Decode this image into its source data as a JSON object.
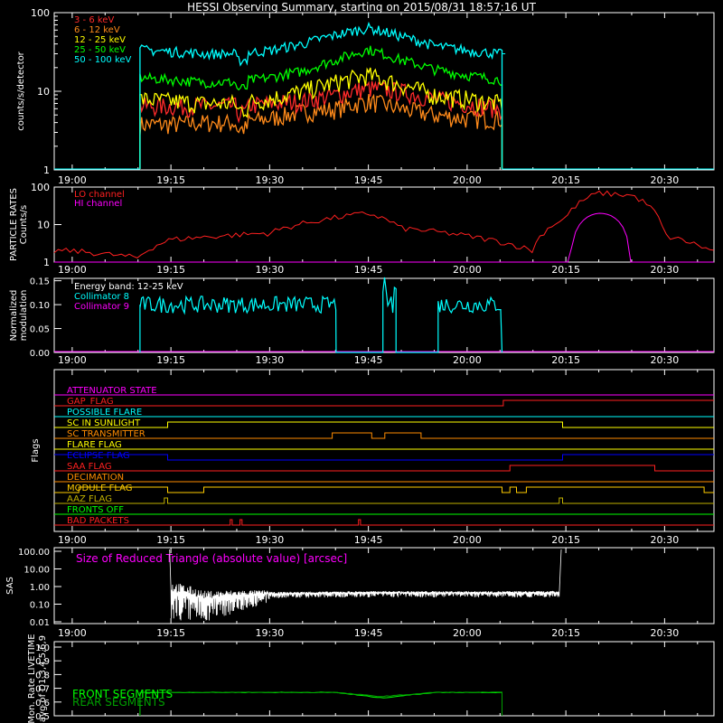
{
  "title": "HESSI Observing Summary, starting on 2015/08/31 18:57:16 UT",
  "colors": {
    "bg": "#000000",
    "fg": "#ffffff",
    "e1": "#ff2a2a",
    "e2": "#ff8a1a",
    "e3": "#ffff00",
    "e4": "#00ff00",
    "e5": "#00ffff",
    "magenta": "#ff00ff",
    "cyan": "#00ffff",
    "green": "#00ff00",
    "blue": "#0000ff",
    "yellow": "#ffff00",
    "orange": "#ff8c00",
    "red": "#ff2020",
    "olive": "#c0b000",
    "gold": "#ffcc00",
    "darkgreen": "#00a000"
  },
  "time_ticks": [
    "19:00",
    "19:15",
    "19:30",
    "19:45",
    "20:00",
    "20:15",
    "20:30"
  ],
  "panels": {
    "counts": {
      "ylabel": "counts/s/detector",
      "yticks": [
        "100",
        "10",
        "1"
      ],
      "legend": [
        "3 - 6 keV",
        "6 - 12 keV",
        "12 - 25 keV",
        "25 - 50 keV",
        "50 - 100 keV"
      ]
    },
    "particle": {
      "ylabel1": "PARTICLE RATES",
      "ylabel2": "Counts/s",
      "yticks": [
        "100",
        "10",
        "1"
      ],
      "legend": [
        "LO channel",
        "HI channel"
      ]
    },
    "modulation": {
      "ylabel1": "Normalized",
      "ylabel2": "modulation",
      "yticks": [
        "0.15",
        "0.10",
        "0.05",
        "0.00"
      ],
      "legend": [
        "Energy band: 12-25 keV",
        "Collimator 8",
        "Collimator 9"
      ]
    },
    "flags": {
      "ylabel": "Flags",
      "labels": [
        "ATTENUATOR STATE",
        "GAP_FLAG",
        "POSSIBLE FLARE",
        "SC IN SUNLIGHT",
        "SC TRANSMITTER",
        "FLARE FLAG",
        "ECLIPSE FLAG",
        "SAA FLAG",
        "DECIMATION",
        "MODULE FLAG",
        "AAZ FLAG",
        "FRONTS OFF",
        "BAD PACKETS"
      ]
    },
    "sas": {
      "ylabel": "SAS",
      "yticks": [
        "100.00",
        "10.00",
        "1.00",
        "0.10",
        "0.01"
      ],
      "legend": "Size of Reduced Triangle (absolute value) [arcsec]"
    },
    "livetime": {
      "ylabel1": "Mon. Rate LIVETIME",
      "ylabel2": "avg of D1,3,4,5,6,9",
      "yticks": [
        "1.0",
        "0.9",
        "0.8",
        "0.7",
        "0.6",
        "0.5"
      ],
      "legend": [
        "FRONT SEGMENTS",
        "REAR SEGMENTS"
      ]
    }
  },
  "chart_data": [
    {
      "type": "line",
      "title": "HESSI Observing Summary, starting on 2015/08/31 18:57:16 UT",
      "ylabel": "counts/s/detector",
      "yscale": "log",
      "ylim": [
        1,
        100
      ],
      "x": [
        "19:10",
        "19:15",
        "19:20",
        "19:25",
        "19:30",
        "19:35",
        "19:40",
        "19:45",
        "19:50",
        "19:55",
        "20:00",
        "20:05"
      ],
      "series": [
        {
          "name": "3 - 6 keV",
          "color": "#ff2a2a",
          "values": [
            6.5,
            6.5,
            6.5,
            6.5,
            7,
            7.5,
            9,
            11,
            10,
            8,
            7,
            6
          ]
        },
        {
          "name": "6 - 12 keV",
          "color": "#ff8a1a",
          "values": [
            3.8,
            3.8,
            4,
            4,
            4.5,
            5.5,
            6,
            7.5,
            6,
            5,
            4.5,
            4.5
          ]
        },
        {
          "name": "12 - 25 keV",
          "color": "#ffff00",
          "values": [
            8,
            7.5,
            7,
            7,
            8,
            10,
            13,
            16,
            12,
            9,
            8,
            7
          ]
        },
        {
          "name": "25 - 50 keV",
          "color": "#00ff00",
          "values": [
            15,
            14,
            13,
            13,
            15,
            18,
            25,
            34,
            25,
            19,
            16,
            14
          ]
        },
        {
          "name": "50 - 100 keV",
          "color": "#00ffff",
          "values": [
            34,
            32,
            30,
            30,
            33,
            40,
            52,
            64,
            50,
            38,
            33,
            30
          ]
        }
      ]
    },
    {
      "type": "line",
      "ylabel": "PARTICLE RATES Counts/s",
      "yscale": "log",
      "ylim": [
        1,
        100
      ],
      "x": [
        "19:00",
        "19:10",
        "19:15",
        "19:30",
        "19:45",
        "19:50",
        "20:00",
        "20:10",
        "20:15",
        "20:20",
        "20:25",
        "20:30",
        "20:37"
      ],
      "series": [
        {
          "name": "LO channel",
          "color": "#ff2020",
          "values": [
            2,
            1.3,
            4,
            6,
            20,
            8,
            5,
            2,
            15,
            70,
            60,
            5,
            2
          ]
        },
        {
          "name": "HI channel",
          "color": "#ff00ff",
          "values": [
            1,
            1,
            1,
            1,
            1,
            1,
            1,
            1,
            1,
            20,
            1,
            1,
            1
          ]
        }
      ]
    },
    {
      "type": "line",
      "ylabel": "Normalized modulation",
      "ylim": [
        0,
        0.15
      ],
      "x": [
        "19:10",
        "19:15",
        "19:30",
        "19:40",
        "19:47",
        "19:50",
        "19:56",
        "20:05"
      ],
      "series": [
        {
          "name": "Collimator 8",
          "color": "#00ffff",
          "values": [
            0.1,
            0.1,
            0.1,
            0.0,
            0.1,
            0.0,
            0.1,
            0.1
          ]
        },
        {
          "name": "Collimator 9",
          "color": "#ff00ff",
          "values": [
            0,
            0,
            0,
            0,
            0,
            0,
            0,
            0
          ]
        }
      ]
    },
    {
      "type": "line",
      "ylabel": "SAS",
      "yscale": "log",
      "ylim": [
        0.01,
        100
      ],
      "x": [
        "19:15",
        "19:20",
        "19:30",
        "19:45",
        "20:00",
        "20:14"
      ],
      "series": [
        {
          "name": "Size of Reduced Triangle (absolute value) [arcsec]",
          "color": "#ffffff",
          "values": [
            0.5,
            0.2,
            0.4,
            0.45,
            0.45,
            0.45
          ]
        }
      ]
    },
    {
      "type": "line",
      "ylabel": "Mon. Rate LIVETIME avg of D1,3,4,5,6,9",
      "ylim": [
        0.5,
        1.0
      ],
      "x": [
        "19:10",
        "19:40",
        "19:47",
        "19:55",
        "20:05"
      ],
      "series": [
        {
          "name": "FRONT SEGMENTS",
          "color": "#00ff00",
          "values": [
            0.67,
            0.67,
            0.63,
            0.67,
            0.67
          ]
        },
        {
          "name": "REAR SEGMENTS",
          "color": "#00a000",
          "values": [
            0.67,
            0.67,
            0.64,
            0.67,
            0.67
          ]
        }
      ]
    }
  ]
}
